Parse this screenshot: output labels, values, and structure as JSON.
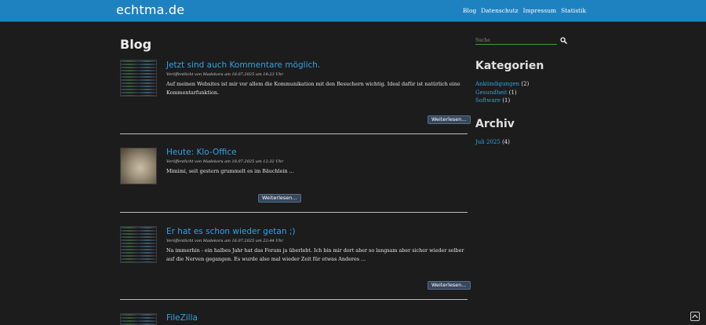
{
  "header": {
    "site_title": "echtma.de",
    "nav": [
      {
        "label": "Blog"
      },
      {
        "label": "Datenschutz"
      },
      {
        "label": "Impressum"
      },
      {
        "label": "Statistik"
      }
    ]
  },
  "main": {
    "page_title": "Blog",
    "posts": [
      {
        "title": "Jetzt sind auch Kommentare möglich.",
        "meta": "Veröffentlicht von Madekoru am 18.07.2025 um 18:23 Uhr",
        "excerpt": "Auf meinen Websites ist mir vor allem die Kommunikation mit den Besuchern wichtig. Ideal dafür ist natürlich eine Kommentarfunktion.",
        "read_more": "Weiterlesen...",
        "thumbnail": "code-screenshot"
      },
      {
        "title": "Heute: Klo-Office",
        "meta": "Veröffentlicht von Madekoru am 18.07.2025 um 12:32 Uhr",
        "excerpt": "Mimimi, seit gestern grummelt es im Bäuchlein ...",
        "read_more": "Weiterlesen...",
        "thumbnail": "photo"
      },
      {
        "title": "Er hat es schon wieder getan ;)",
        "meta": "Veröffentlicht von Madekoru am 16.07.2025 um 22:44 Uhr",
        "excerpt": "Na immerhin - ein halbes Jahr hat das Forum ja überlebt. Ich bin mir dort aber so langsam aber sicher wieder selber auf die Nerven gegangen. Es wurde also mal wieder Zeit für etwas Anderes ...",
        "read_more": "Weiterlesen...",
        "thumbnail": "code-screenshot"
      },
      {
        "title": "FileZilla",
        "thumbnail": "code-screenshot"
      }
    ]
  },
  "sidebar": {
    "search_placeholder": "Suche",
    "categories_heading": "Kategorien",
    "categories": [
      {
        "name": "Ankündigungen",
        "count": "(2)"
      },
      {
        "name": "Gesundheit",
        "count": "(1)"
      },
      {
        "name": "Software",
        "count": "(1)"
      }
    ],
    "archive_heading": "Archiv",
    "archive": [
      {
        "name": "Juli 2025",
        "count": "(4)"
      }
    ]
  },
  "colors": {
    "header_bg": "#1f82c0",
    "page_bg": "#1c1c1c",
    "link": "#2ea3e6",
    "button_bg": "#36475c"
  }
}
